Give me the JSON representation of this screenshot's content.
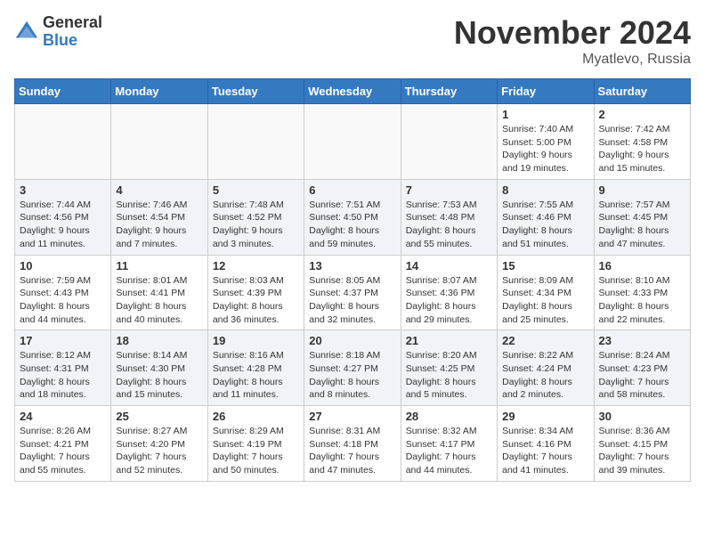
{
  "logo": {
    "general": "General",
    "blue": "Blue"
  },
  "title": "November 2024",
  "location": "Myatlevo, Russia",
  "weekdays": [
    "Sunday",
    "Monday",
    "Tuesday",
    "Wednesday",
    "Thursday",
    "Friday",
    "Saturday"
  ],
  "weeks": [
    [
      {
        "day": "",
        "info": ""
      },
      {
        "day": "",
        "info": ""
      },
      {
        "day": "",
        "info": ""
      },
      {
        "day": "",
        "info": ""
      },
      {
        "day": "",
        "info": ""
      },
      {
        "day": "1",
        "info": "Sunrise: 7:40 AM\nSunset: 5:00 PM\nDaylight: 9 hours and 19 minutes."
      },
      {
        "day": "2",
        "info": "Sunrise: 7:42 AM\nSunset: 4:58 PM\nDaylight: 9 hours and 15 minutes."
      }
    ],
    [
      {
        "day": "3",
        "info": "Sunrise: 7:44 AM\nSunset: 4:56 PM\nDaylight: 9 hours and 11 minutes."
      },
      {
        "day": "4",
        "info": "Sunrise: 7:46 AM\nSunset: 4:54 PM\nDaylight: 9 hours and 7 minutes."
      },
      {
        "day": "5",
        "info": "Sunrise: 7:48 AM\nSunset: 4:52 PM\nDaylight: 9 hours and 3 minutes."
      },
      {
        "day": "6",
        "info": "Sunrise: 7:51 AM\nSunset: 4:50 PM\nDaylight: 8 hours and 59 minutes."
      },
      {
        "day": "7",
        "info": "Sunrise: 7:53 AM\nSunset: 4:48 PM\nDaylight: 8 hours and 55 minutes."
      },
      {
        "day": "8",
        "info": "Sunrise: 7:55 AM\nSunset: 4:46 PM\nDaylight: 8 hours and 51 minutes."
      },
      {
        "day": "9",
        "info": "Sunrise: 7:57 AM\nSunset: 4:45 PM\nDaylight: 8 hours and 47 minutes."
      }
    ],
    [
      {
        "day": "10",
        "info": "Sunrise: 7:59 AM\nSunset: 4:43 PM\nDaylight: 8 hours and 44 minutes."
      },
      {
        "day": "11",
        "info": "Sunrise: 8:01 AM\nSunset: 4:41 PM\nDaylight: 8 hours and 40 minutes."
      },
      {
        "day": "12",
        "info": "Sunrise: 8:03 AM\nSunset: 4:39 PM\nDaylight: 8 hours and 36 minutes."
      },
      {
        "day": "13",
        "info": "Sunrise: 8:05 AM\nSunset: 4:37 PM\nDaylight: 8 hours and 32 minutes."
      },
      {
        "day": "14",
        "info": "Sunrise: 8:07 AM\nSunset: 4:36 PM\nDaylight: 8 hours and 29 minutes."
      },
      {
        "day": "15",
        "info": "Sunrise: 8:09 AM\nSunset: 4:34 PM\nDaylight: 8 hours and 25 minutes."
      },
      {
        "day": "16",
        "info": "Sunrise: 8:10 AM\nSunset: 4:33 PM\nDaylight: 8 hours and 22 minutes."
      }
    ],
    [
      {
        "day": "17",
        "info": "Sunrise: 8:12 AM\nSunset: 4:31 PM\nDaylight: 8 hours and 18 minutes."
      },
      {
        "day": "18",
        "info": "Sunrise: 8:14 AM\nSunset: 4:30 PM\nDaylight: 8 hours and 15 minutes."
      },
      {
        "day": "19",
        "info": "Sunrise: 8:16 AM\nSunset: 4:28 PM\nDaylight: 8 hours and 11 minutes."
      },
      {
        "day": "20",
        "info": "Sunrise: 8:18 AM\nSunset: 4:27 PM\nDaylight: 8 hours and 8 minutes."
      },
      {
        "day": "21",
        "info": "Sunrise: 8:20 AM\nSunset: 4:25 PM\nDaylight: 8 hours and 5 minutes."
      },
      {
        "day": "22",
        "info": "Sunrise: 8:22 AM\nSunset: 4:24 PM\nDaylight: 8 hours and 2 minutes."
      },
      {
        "day": "23",
        "info": "Sunrise: 8:24 AM\nSunset: 4:23 PM\nDaylight: 7 hours and 58 minutes."
      }
    ],
    [
      {
        "day": "24",
        "info": "Sunrise: 8:26 AM\nSunset: 4:21 PM\nDaylight: 7 hours and 55 minutes."
      },
      {
        "day": "25",
        "info": "Sunrise: 8:27 AM\nSunset: 4:20 PM\nDaylight: 7 hours and 52 minutes."
      },
      {
        "day": "26",
        "info": "Sunrise: 8:29 AM\nSunset: 4:19 PM\nDaylight: 7 hours and 50 minutes."
      },
      {
        "day": "27",
        "info": "Sunrise: 8:31 AM\nSunset: 4:18 PM\nDaylight: 7 hours and 47 minutes."
      },
      {
        "day": "28",
        "info": "Sunrise: 8:32 AM\nSunset: 4:17 PM\nDaylight: 7 hours and 44 minutes."
      },
      {
        "day": "29",
        "info": "Sunrise: 8:34 AM\nSunset: 4:16 PM\nDaylight: 7 hours and 41 minutes."
      },
      {
        "day": "30",
        "info": "Sunrise: 8:36 AM\nSunset: 4:15 PM\nDaylight: 7 hours and 39 minutes."
      }
    ]
  ]
}
